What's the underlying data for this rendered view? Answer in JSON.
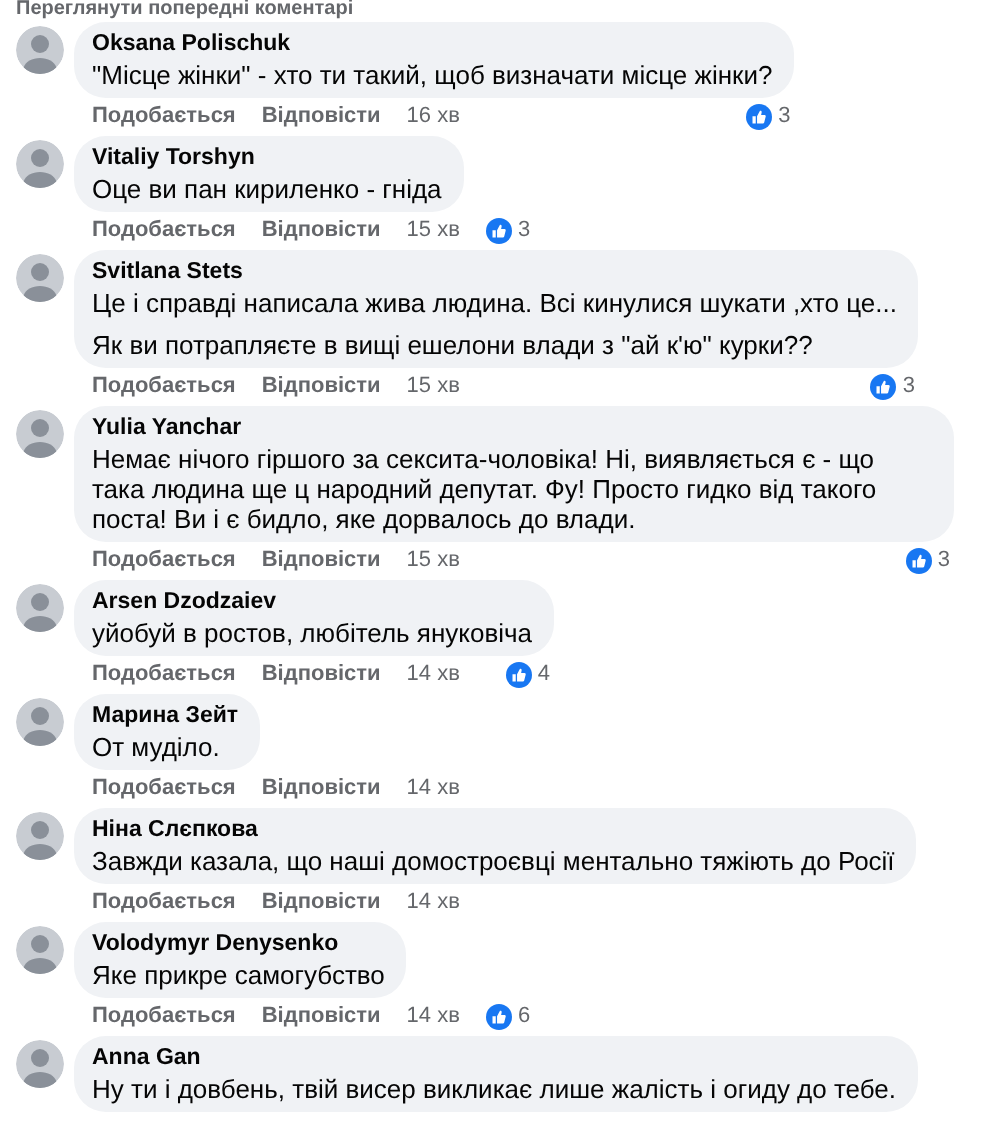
{
  "header": {
    "link": "Переглянути попередні коментарі"
  },
  "comments": [
    {
      "author": "Oksana Polischuk",
      "paragraphs": [
        "\"Місце жінки\" - хто ти такий, щоб визначати місце жінки?"
      ],
      "like": "Подобається",
      "reply": "Відповісти",
      "time": "16 хв",
      "reactions": "3"
    },
    {
      "author": "Vitaliy Torshyn",
      "paragraphs": [
        "Оце ви пан кириленко - гніда"
      ],
      "like": "Подобається",
      "reply": "Відповісти",
      "time": "15 хв",
      "reactions": "3"
    },
    {
      "author": "Svitlana Stets",
      "paragraphs": [
        "Це і справді написала жива людина. Всі кинулися шукати ,хто це...",
        "Як ви потрапляєте в вищі ешелони влади з \"ай к'ю\" курки??"
      ],
      "like": "Подобається",
      "reply": "Відповісти",
      "time": "15 хв",
      "reactions": "3"
    },
    {
      "author": "Yulia Yanchar",
      "paragraphs": [
        "Немає нічого гіршого за сексита-чоловіка! Ні, виявляється є - що така людина ще ц народний депутат. Фу! Просто гидко від такого поста! Ви і є бидло, яке дорвалось до влади."
      ],
      "like": "Подобається",
      "reply": "Відповісти",
      "time": "15 хв",
      "reactions": "3"
    },
    {
      "author": "Arsen Dzodzaiev",
      "paragraphs": [
        "уйобуй в ростов, любітель януковіча"
      ],
      "like": "Подобається",
      "reply": "Відповісти",
      "time": "14 хв",
      "reactions": "4"
    },
    {
      "author": "Марина Зейт",
      "paragraphs": [
        "От муділо."
      ],
      "like": "Подобається",
      "reply": "Відповісти",
      "time": "14 хв"
    },
    {
      "author": "Ніна Слєпкова",
      "paragraphs": [
        "Завжди казала, що наші домостроєвці ментально тяжіють до Росії"
      ],
      "like": "Подобається",
      "reply": "Відповісти",
      "time": "14 хв"
    },
    {
      "author": "Volodymyr Denysenko",
      "paragraphs": [
        "Яке прикре самогубство"
      ],
      "like": "Подобається",
      "reply": "Відповісти",
      "time": "14 хв",
      "reactions": "6"
    },
    {
      "author": "Anna Gan",
      "paragraphs": [
        "Ну ти і довбень, твій висер викликає лише жалість і огиду до тебе."
      ]
    }
  ]
}
